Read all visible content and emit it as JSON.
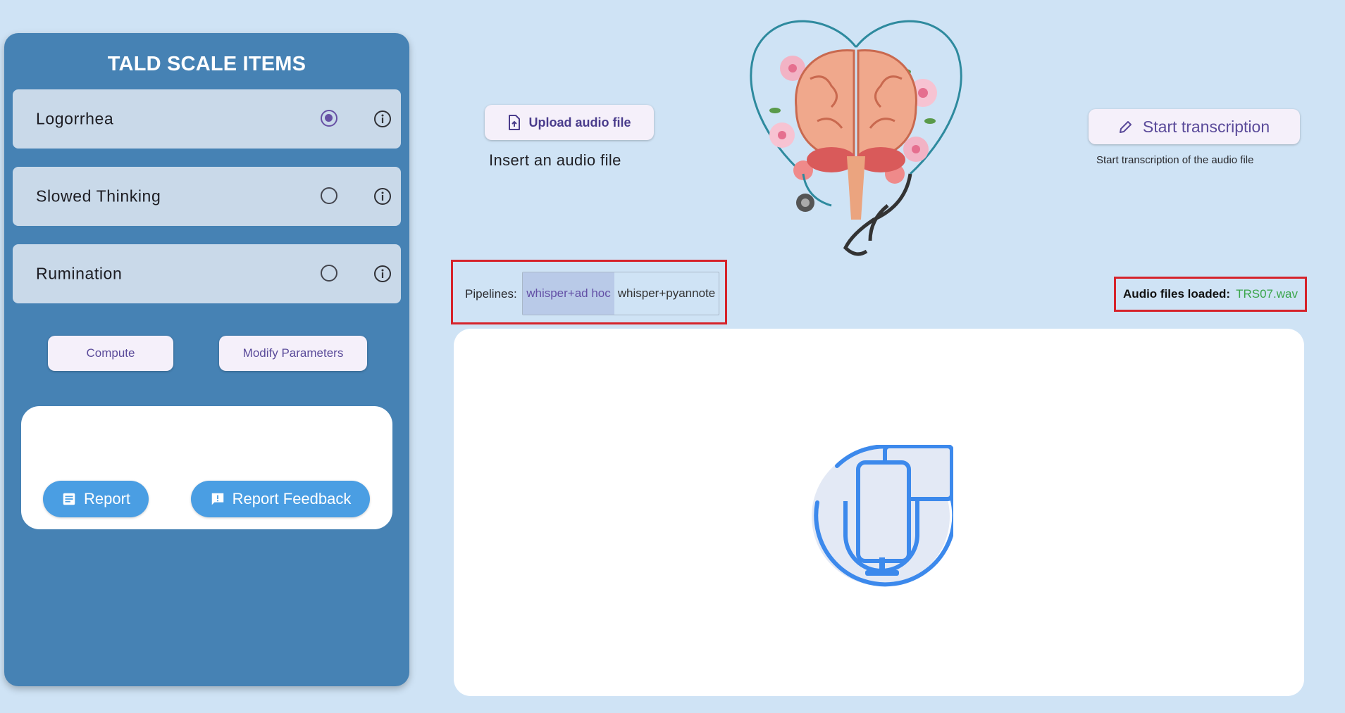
{
  "sidebar": {
    "title": "TALD SCALE ITEMS",
    "items": [
      {
        "label": "Logorrhea",
        "selected": true
      },
      {
        "label": "Slowed Thinking",
        "selected": false
      },
      {
        "label": "Rumination",
        "selected": false
      }
    ],
    "compute_label": "Compute",
    "modify_label": "Modify Parameters",
    "report_label": "Report",
    "report_feedback_label": "Report Feedback"
  },
  "upload": {
    "button_label": "Upload audio file",
    "caption": "Insert an audio file"
  },
  "transcription": {
    "button_label": "Start transcription",
    "caption": "Start transcription of the audio file"
  },
  "pipelines": {
    "label": "Pipelines:",
    "options": [
      "whisper+ad hoc",
      "whisper+pyannote"
    ],
    "selected": "whisper+ad hoc"
  },
  "audio_files": {
    "label": "Audio files loaded:",
    "value": "TRS07.wav"
  },
  "colors": {
    "background": "#cfe3f5",
    "sidebar": "#4682b4",
    "accent": "#6750a4",
    "report_button": "#4a9ee3",
    "highlight_border": "#d6232b",
    "file_loaded": "#3aa54a"
  },
  "icons": [
    "info-icon",
    "upload-file-icon",
    "pencil-icon",
    "report-icon",
    "feedback-icon",
    "podcast-mic-icon",
    "brain-heart-illustration"
  ]
}
